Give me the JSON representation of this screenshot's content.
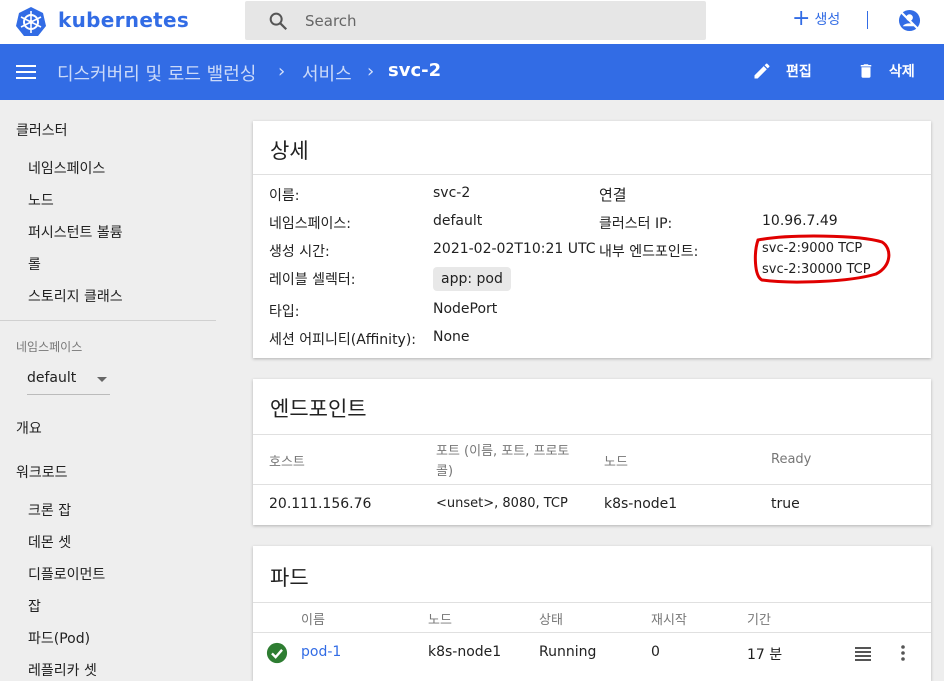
{
  "brand": {
    "name": "kubernetes"
  },
  "search": {
    "placeholder": "Search"
  },
  "topbar": {
    "create_label": "생성"
  },
  "header": {
    "breadcrumb": [
      "디스커버리 및 로드 밸런싱",
      "서비스",
      "svc-2"
    ],
    "edit_label": "편집",
    "delete_label": "삭제"
  },
  "sidebar": {
    "cluster_label": "클러스터",
    "cluster_items": [
      "네임스페이스",
      "노드",
      "퍼시스턴트 볼륨",
      "롤",
      "스토리지 클래스"
    ],
    "namespace_label": "네임스페이스",
    "namespace_value": "default",
    "overview_label": "개요",
    "workload_label": "워크로드",
    "workload_items": [
      "크론 잡",
      "데몬 셋",
      "디플로이먼트",
      "잡",
      "파드(Pod)",
      "레플리카 셋"
    ]
  },
  "details": {
    "title": "상세",
    "name_label": "이름:",
    "name_value": "svc-2",
    "namespace_label": "네임스페이스:",
    "namespace_value": "default",
    "created_label": "생성 시간:",
    "created_value": "2021-02-02T10:21 UTC",
    "selector_label": "레이블 셀렉터:",
    "selector_value": "app: pod",
    "type_label": "타입:",
    "type_value": "NodePort",
    "affinity_label": "세션 어피니티(Affinity):",
    "affinity_value": "None",
    "connection_title": "연결",
    "cluster_ip_label": "클러스터 IP:",
    "cluster_ip_value": "10.96.7.49",
    "internal_endpoints_label": "내부 엔드포인트:",
    "internal_endpoints": [
      "svc-2:9000 TCP",
      "svc-2:30000 TCP"
    ],
    "annotation_color": "#e00000"
  },
  "endpoints": {
    "title": "엔드포인트",
    "headers": [
      "호스트",
      "포트 (이름, 포트, 프로토",
      "콜)",
      "노드",
      "Ready"
    ],
    "row": {
      "host": "20.111.156.76",
      "ports": "<unset>, 8080, TCP",
      "node": "k8s-node1",
      "ready": "true"
    }
  },
  "pods": {
    "title": "파드",
    "headers": [
      "이름",
      "노드",
      "상태",
      "재시작",
      "기간"
    ],
    "row": {
      "name": "pod-1",
      "node": "k8s-node1",
      "status": "Running",
      "restarts": "0",
      "age": "17 분"
    },
    "status_color": "#2e7d32"
  },
  "colors": {
    "primary": "#326ce5",
    "background": "#eeeeee"
  }
}
